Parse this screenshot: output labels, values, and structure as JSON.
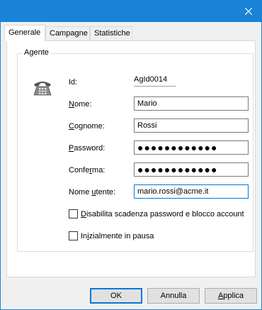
{
  "window": {
    "close_icon": "close-icon"
  },
  "tabs": [
    {
      "label": "Generale",
      "active": true
    },
    {
      "label": "Campagne",
      "active": false
    },
    {
      "label": "Statistiche",
      "active": false
    }
  ],
  "group": {
    "title": "Agente",
    "icon": "telephone-icon",
    "fields": {
      "id": {
        "label": "Id:",
        "value": "AgId0014"
      },
      "nome": {
        "label_mnemonic": "N",
        "label_rest": "ome:",
        "value": "Mario"
      },
      "cognome": {
        "label_mnemonic": "C",
        "label_rest": "ognome:",
        "value": "Rossi"
      },
      "password": {
        "label_mnemonic": "P",
        "label_rest": "assword:",
        "value": "●●●●●●●●●●●●"
      },
      "conferma": {
        "label_pre": "Confe",
        "label_mnemonic": "r",
        "label_rest": "ma:",
        "value": "●●●●●●●●●●●●"
      },
      "username": {
        "label_pre": "Nome ",
        "label_mnemonic": "u",
        "label_rest": "tente:",
        "value": "mario.rossi@acme.it"
      }
    },
    "checkboxes": [
      {
        "mnemonic": "D",
        "rest": "isabilita scadenza password e blocco account",
        "checked": false
      },
      {
        "pre": "In",
        "mnemonic": "i",
        "rest": "zialmente in pausa",
        "checked": false
      }
    ]
  },
  "buttons": {
    "ok": "OK",
    "cancel": "Annulla",
    "apply_mnemonic": "A",
    "apply_rest": "pplica"
  },
  "colors": {
    "titlebar": "#1883d7",
    "focus": "#0078d7"
  }
}
